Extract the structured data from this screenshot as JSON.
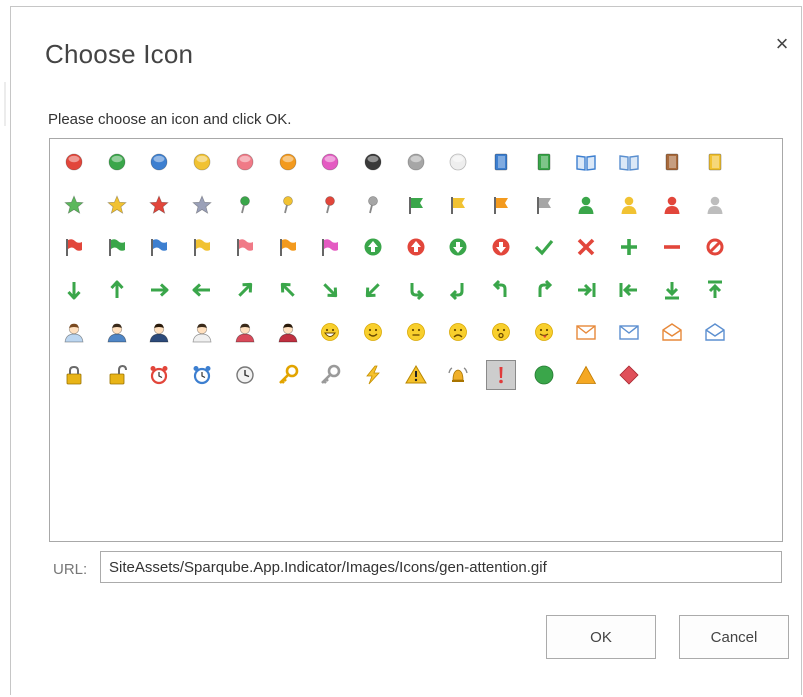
{
  "dialog": {
    "title": "Choose Icon",
    "close_symbol": "×",
    "instruction": "Please choose an icon and click OK.",
    "url_label": "URL:",
    "url_value": "SiteAssets/Sparqube.App.Indicator/Images/Icons/gen-attention.gif",
    "ok_label": "OK",
    "cancel_label": "Cancel"
  },
  "selected_icon": "gen-attention",
  "icon_rows": [
    [
      "ball-red",
      "ball-green",
      "ball-blue",
      "ball-yellow",
      "ball-pink",
      "ball-orange",
      "ball-magenta",
      "ball-black",
      "ball-gray",
      "ball-white",
      "book-closed-blue",
      "book-closed-green",
      "book-open-blue",
      "book-open-blue-2",
      "book-closed-brown",
      "book-closed-yellow"
    ],
    [
      "star-green",
      "star-yellow",
      "star-red",
      "star-gray",
      "pin-green",
      "pin-yellow",
      "pin-red",
      "pin-gray",
      "flag-green",
      "flag-yellow",
      "flag-orange",
      "flag-gray",
      "user-green",
      "user-yellow",
      "user-red",
      "user-gray"
    ],
    [
      "flag-red",
      "flag-green-2",
      "flag-blue",
      "flag-yellow-2",
      "flag-pink",
      "flag-orange-2",
      "flag-magenta",
      "circle-arrow-up-green",
      "circle-arrow-up-red",
      "circle-arrow-down-green",
      "circle-arrow-down-red",
      "checkmark",
      "cross",
      "plus",
      "minus",
      "no-entry"
    ],
    [
      "arrow-down",
      "arrow-up",
      "arrow-right",
      "arrow-left",
      "arrow-up-right",
      "arrow-up-left",
      "arrow-down-right",
      "arrow-down-left",
      "arrow-turn-down-left",
      "arrow-turn-down-right",
      "arrow-turn-up-right",
      "arrow-turn-up-left",
      "arrow-to-end",
      "arrow-to-start",
      "arrow-to-bottom",
      "arrow-to-top"
    ],
    [
      "person-blue",
      "person-blue-2",
      "person-dark",
      "person-girl",
      "person-red",
      "person-red-2",
      "smiley-laughing",
      "smiley-happy",
      "smiley-neutral",
      "smiley-sad",
      "smiley-surprised",
      "smiley-tongue",
      "mail-orange",
      "mail-blue",
      "mail-open-orange",
      "mail-open-blue"
    ],
    [
      "lock-closed",
      "lock-open",
      "alarm-clock-red",
      "alarm-clock-blue",
      "clock",
      "key-gold",
      "key-gray",
      "lightning",
      "warning",
      "bell-ringing",
      "gen-attention",
      "circle-green",
      "triangle-orange",
      "diamond-red"
    ]
  ],
  "colors": {
    "red": "#e2463b",
    "green": "#3aa64a",
    "blue": "#3d7fd0",
    "yellow": "#f1c232",
    "pink": "#f07a87",
    "orange": "#f39a1e",
    "magenta": "#e45bc2",
    "black": "#3a3a3a",
    "gray": "#a6a6a6",
    "white": "#eeeeee",
    "brown": "#a86a3c"
  }
}
